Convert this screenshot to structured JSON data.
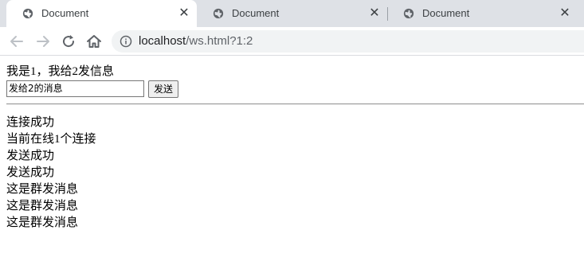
{
  "browser": {
    "tabs": [
      {
        "title": "Document",
        "active": true,
        "icon": "globe-icon"
      },
      {
        "title": "Document",
        "active": false,
        "icon": "globe-icon"
      },
      {
        "title": "Document",
        "active": false,
        "icon": "globe-icon"
      }
    ],
    "close_glyph": "✕",
    "address": {
      "host": "localhost",
      "rest": "/ws.html?1:2"
    },
    "colors": {
      "tabstrip": "#dee1e6",
      "omnibox": "#f1f3f4"
    }
  },
  "page": {
    "intro": "我是1，我给2发信息",
    "message_input": {
      "value": "发给2的消息"
    },
    "send_label": "发送",
    "log": [
      "连接成功",
      "当前在线1个连接",
      "发送成功",
      "发送成功",
      "这是群发消息",
      "这是群发消息",
      "这是群发消息"
    ]
  }
}
